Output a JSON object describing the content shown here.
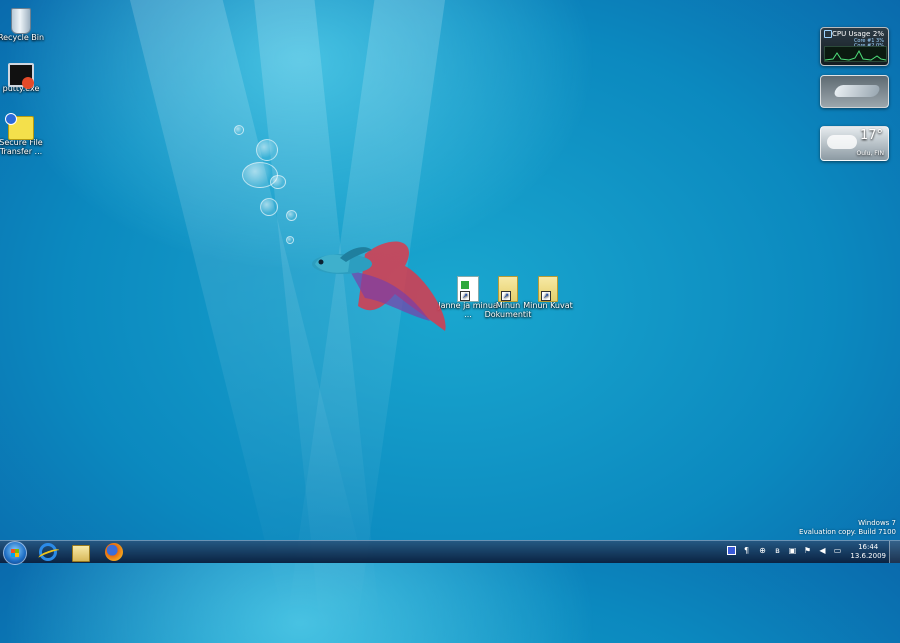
{
  "desktop": {
    "icons": [
      {
        "label": "Recycle Bin",
        "icon": "recycle-bin-icon"
      },
      {
        "label": "putty.exe",
        "icon": "putty-icon"
      },
      {
        "label": "Secure File Transfer ...",
        "icon": "secure-file-transfer-icon"
      },
      {
        "label": "Janne ja minua ...",
        "icon": "document-shortcut-icon"
      },
      {
        "label": "Minun Dokumentit",
        "icon": "folder-shortcut-icon"
      },
      {
        "label": "Minun Kuvat",
        "icon": "folder-shortcut-icon"
      }
    ]
  },
  "gadgets": {
    "cpu": {
      "title": "CPU Usage",
      "percent": "2%",
      "core1": "Core #1   3%",
      "core2": "Core #2   0%"
    },
    "weather": {
      "temp": "17°",
      "location": "Oulu, FIN"
    }
  },
  "watermark": {
    "line1": "Windows 7",
    "line2": "Evaluation copy. Build 7100"
  },
  "taskbar": {
    "pinned": [
      "internet-explorer-icon",
      "windows-explorer-icon",
      "firefox-icon"
    ],
    "clock": {
      "time": "16:44",
      "date": "13.6.2009"
    }
  }
}
